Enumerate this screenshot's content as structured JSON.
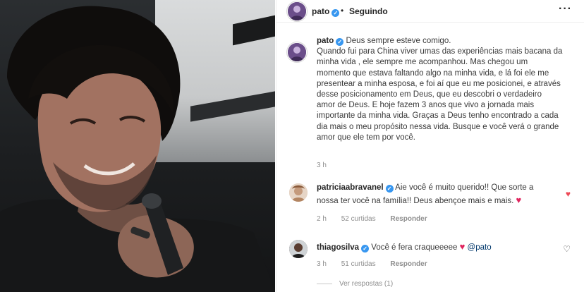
{
  "header": {
    "username": "pato",
    "separator": "•",
    "follow_state": "Seguindo",
    "more_icon": "more-horizontal-icon"
  },
  "caption": {
    "username": "pato",
    "lines": [
      "Deus sempre esteve comigo.",
      "Quando fui para China viver umas das experiências mais bacana da",
      "minha vida , ele sempre me acompanhou. Mas chegou um",
      "momento que estava faltando algo na minha vida, e lá foi ele me",
      "presentear a minha esposa, e foi aí que eu me posicionei, e através",
      "desse posicionamento em Deus, que eu descobri o verdadeiro",
      "amor de Deus. E hoje fazem 3 anos que vivo a jornada mais",
      "importante da minha vida. Graças a Deus tenho encontrado a cada",
      "dia mais o meu propósito nessa vida. Busque e você verá o grande",
      "amor que ele tem por você."
    ],
    "time": "3 h"
  },
  "comments": [
    {
      "username": "patriciaabravanel",
      "lines": [
        "Aie você é muito querido!! Que sorte a",
        "nossa ter você na família!! Deus abençoe mais e mais."
      ],
      "emoji": "♥",
      "time": "2 h",
      "likes": "52 curtidas",
      "reply": "Responder",
      "liked": true,
      "like_color": "#ed4956"
    },
    {
      "username": "thiagosilva",
      "lines": [
        "Você é fera craqueeeee"
      ],
      "emoji": "♥",
      "mention": "@pato",
      "time": "3 h",
      "likes": "51 curtidas",
      "reply": "Responder",
      "liked": false
    }
  ],
  "view_replies": "Ver respostas (1)",
  "colors": {
    "verified": "#3897f0",
    "like_red": "#ed4956",
    "muted": "#8e8e8e",
    "text": "#262626"
  }
}
